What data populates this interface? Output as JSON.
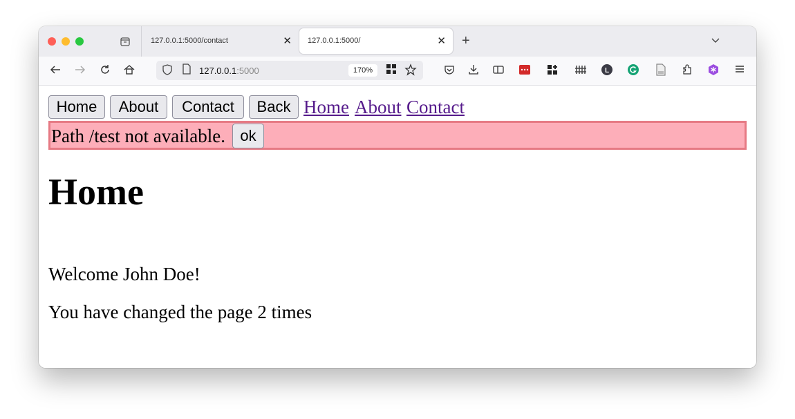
{
  "browser": {
    "tabs": [
      {
        "title": "127.0.0.1:5000/contact",
        "close": "✕"
      },
      {
        "title": "127.0.0.1:5000/",
        "close": "✕"
      }
    ],
    "new_tab": "+",
    "tab_list": "⌵",
    "url_host": "127.0.0.1",
    "url_port": ":5000",
    "zoom": "170%"
  },
  "nav": {
    "buttons": [
      "Home",
      "About",
      "Contact",
      "Back"
    ],
    "links": [
      "Home",
      "About",
      "Contact"
    ]
  },
  "alert": {
    "message": "Path /test not available.",
    "ok_label": "ok"
  },
  "main": {
    "heading": "Home",
    "welcome": "Welcome John Doe!",
    "counter": "You have changed the page 2 times"
  },
  "colors": {
    "alert_bg": "#fdaeb9",
    "alert_border": "#e67a84",
    "link": "#551a8b"
  }
}
